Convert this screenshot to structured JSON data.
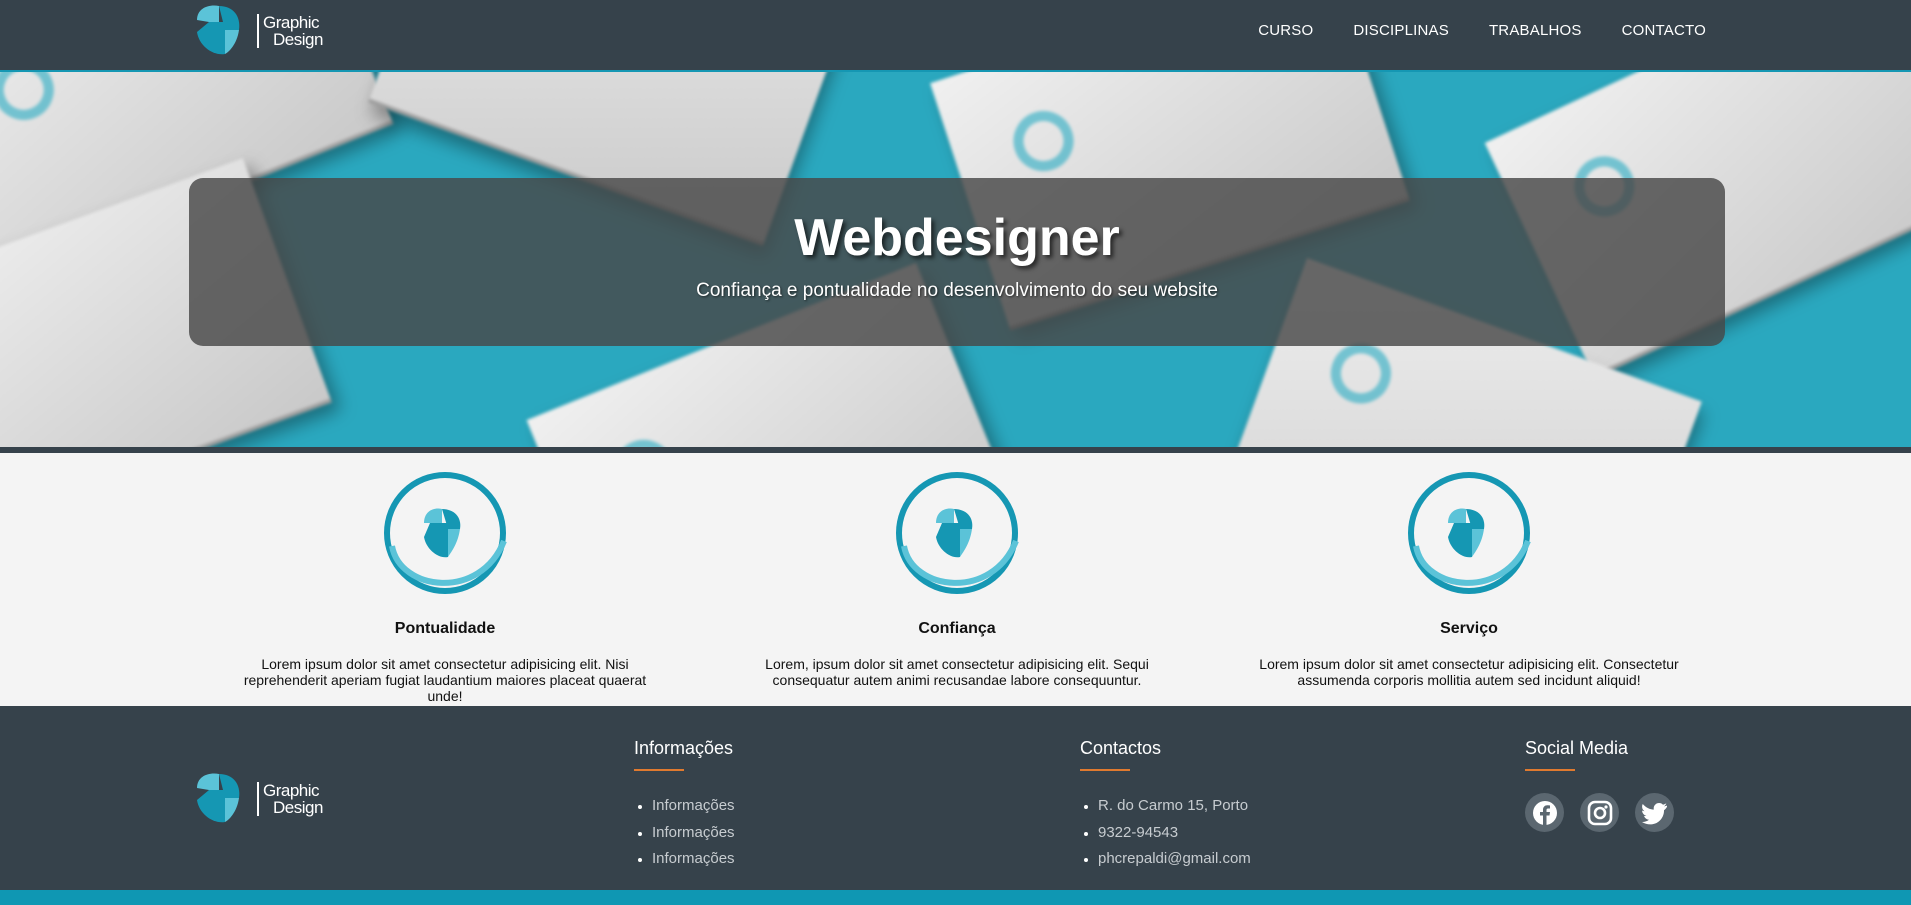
{
  "header": {
    "logo_line1": "Graphic",
    "logo_line2": "Design",
    "nav": [
      "CURSO",
      "DISCIPLINAS",
      "TRABALHOS",
      "CONTACTO"
    ]
  },
  "hero": {
    "title": "Webdesigner",
    "subtitle": "Confiança e pontualidade no desenvolvimento do seu website"
  },
  "features": [
    {
      "title": "Pontualidade",
      "text": "Lorem ipsum dolor sit amet consectetur adipisicing elit. Nisi reprehenderit aperiam fugiat laudantium maiores placeat quaerat unde!"
    },
    {
      "title": "Confiança",
      "text": "Lorem, ipsum dolor sit amet consectetur adipisicing elit. Sequi consequatur autem animi recusandae labore consequuntur."
    },
    {
      "title": "Serviço",
      "text": "Lorem ipsum dolor sit amet consectetur adipisicing elit. Consectetur assumenda corporis mollitia autem sed incidunt aliquid!"
    }
  ],
  "footer": {
    "logo_line1": "Graphic",
    "logo_line2": "Design",
    "info": {
      "heading": "Informações",
      "items": [
        "Informações",
        "Informações",
        "Informações"
      ]
    },
    "contacts": {
      "heading": "Contactos",
      "items": [
        "R. do Carmo 15, Porto",
        "9322-94543",
        "phcrepaldi@gmail.com"
      ]
    },
    "social": {
      "heading": "Social Media",
      "icons": [
        "facebook-icon",
        "instagram-icon",
        "twitter-icon"
      ]
    }
  },
  "colors": {
    "header_bg": "#36424b",
    "accent_teal": "#1597b3",
    "accent_orange": "#e07a2f",
    "hero_bg": "#2aa8bf"
  }
}
